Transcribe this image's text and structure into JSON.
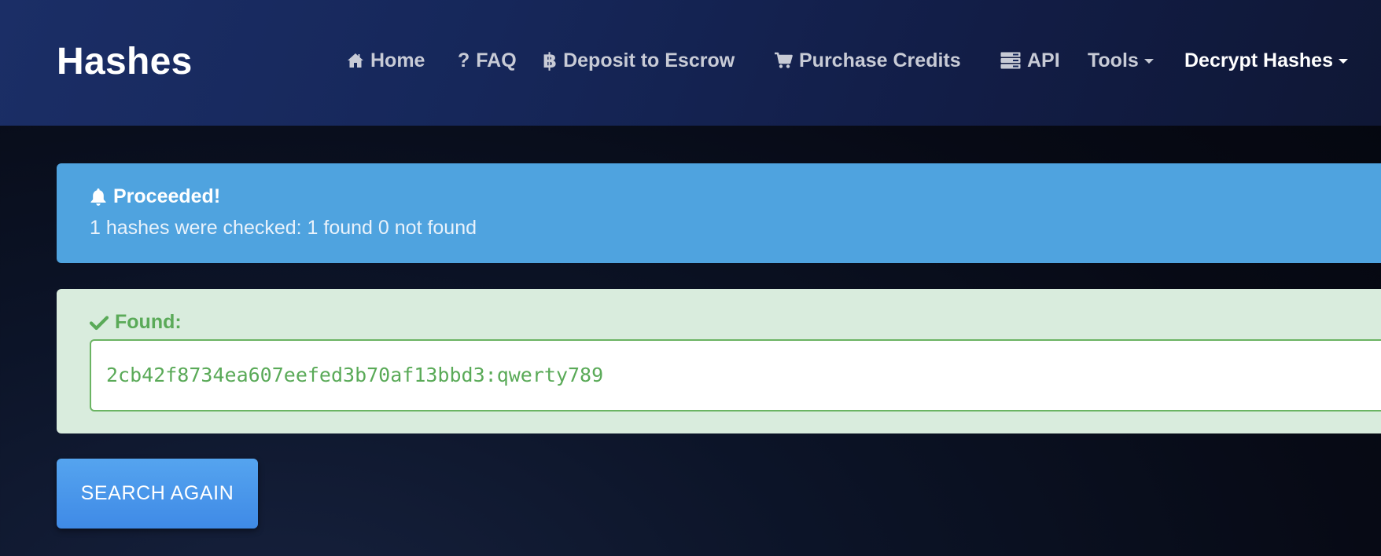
{
  "navbar": {
    "brand": "Hashes",
    "items": [
      {
        "label": "Home",
        "icon": "home-icon"
      },
      {
        "label": "FAQ",
        "icon": "question-icon"
      },
      {
        "label": "Deposit to Escrow",
        "icon": "bitcoin-icon"
      },
      {
        "label": "Purchase Credits",
        "icon": "cart-icon"
      },
      {
        "label": "API",
        "icon": "server-icon"
      },
      {
        "label": "Tools",
        "dropdown": true
      },
      {
        "label": "Decrypt Hashes",
        "dropdown": true,
        "active": true
      }
    ]
  },
  "alert": {
    "icon": "bell-icon",
    "title": "Proceeded!",
    "message": "1 hashes were checked: 1 found 0 not found",
    "color": "#4fa3df"
  },
  "result": {
    "icon": "check-icon",
    "label": "Found:",
    "value": "2cb42f8734ea607eefed3b70af13bbd3:qwerty789",
    "color": "#5aaa58"
  },
  "actions": {
    "search_again_label": "SEARCH AGAIN"
  }
}
